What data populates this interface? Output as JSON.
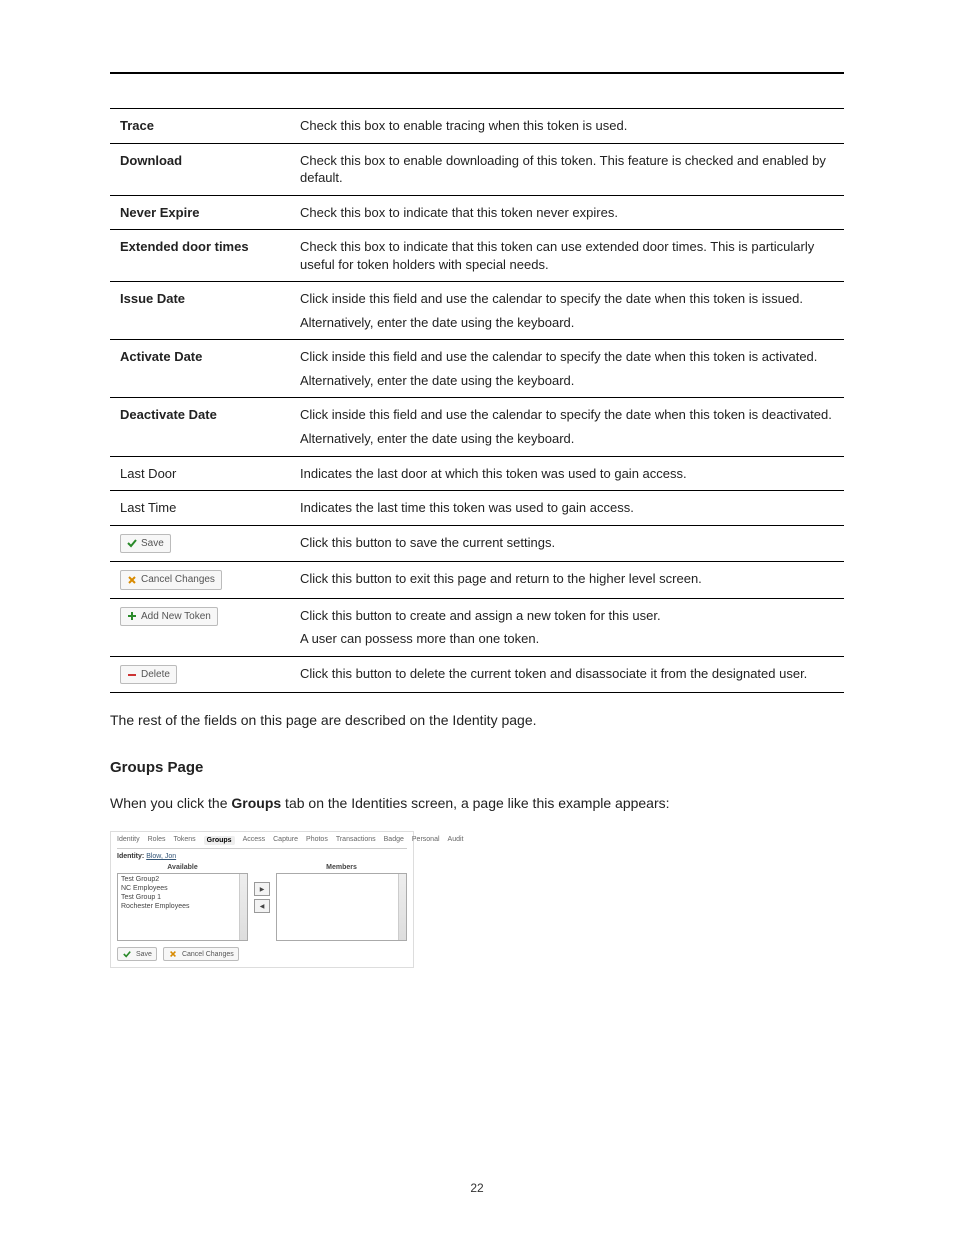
{
  "table": {
    "rows": [
      {
        "label": "Trace",
        "bold": true,
        "btn": null,
        "paras": [
          "Check this box to enable tracing when this token is used."
        ]
      },
      {
        "label": "Download",
        "bold": true,
        "btn": null,
        "paras": [
          "Check this box to enable downloading of this token. This feature is checked and enabled by default."
        ]
      },
      {
        "label": "Never Expire",
        "bold": true,
        "btn": null,
        "paras": [
          "Check this box to indicate that this token never expires."
        ]
      },
      {
        "label": "Extended door times",
        "bold": true,
        "btn": null,
        "paras": [
          "Check this box to indicate that this token can use extended door times. This is particularly useful for token holders with special needs."
        ]
      },
      {
        "label": "Issue Date",
        "bold": true,
        "btn": null,
        "paras": [
          "Click inside this field and use the calendar to specify the date when this token is issued.",
          "Alternatively, enter the date using the keyboard."
        ]
      },
      {
        "label": "Activate Date",
        "bold": true,
        "btn": null,
        "paras": [
          "Click inside this field and use the calendar to specify the date when this token is activated.",
          "Alternatively, enter the date using the keyboard."
        ]
      },
      {
        "label": "Deactivate Date",
        "bold": true,
        "btn": null,
        "paras": [
          "Click inside this field and use the calendar to specify the date when this token is deactivated.",
          "Alternatively, enter the date using the keyboard."
        ]
      },
      {
        "label": "Last Door",
        "bold": false,
        "btn": null,
        "paras": [
          "Indicates the last door at which this token was used to gain access."
        ]
      },
      {
        "label": "Last Time",
        "bold": false,
        "btn": null,
        "paras": [
          "Indicates the last time this token was used to gain access."
        ]
      },
      {
        "label": "",
        "bold": false,
        "btn": {
          "icon": "check",
          "text": "Save"
        },
        "paras": [
          "Click this button to save the current settings."
        ]
      },
      {
        "label": "",
        "bold": false,
        "btn": {
          "icon": "cancel",
          "text": "Cancel Changes"
        },
        "paras": [
          "Click this button to exit this page and return to the higher level screen."
        ]
      },
      {
        "label": "",
        "bold": false,
        "btn": {
          "icon": "plus",
          "text": "Add New Token"
        },
        "paras": [
          "Click this button to create and assign a new token for this user.",
          "A user can possess more than one token."
        ]
      },
      {
        "label": "",
        "bold": false,
        "btn": {
          "icon": "minus",
          "text": "Delete"
        },
        "paras": [
          "Click this button to delete the current token and disassociate it from the designated user."
        ]
      }
    ]
  },
  "body_after_table": "The rest of the fields on this page are described on the Identity page.",
  "section_heading": "Groups Page",
  "groups_intro_prefix": "When you click the ",
  "groups_intro_bold": "Groups",
  "groups_intro_suffix": " tab on the Identities screen, a page like this example appears:",
  "screenshot": {
    "tabs": [
      "Identity",
      "Roles",
      "Tokens",
      "Groups",
      "Access",
      "Capture",
      "Photos",
      "Transactions",
      "Badge",
      "Personal",
      "Audit"
    ],
    "active_tab": "Groups",
    "identity_label": "Identity:",
    "identity_value": "Blow, Jon",
    "available_title": "Available",
    "members_title": "Members",
    "available_items": [
      "Test Group2",
      "NC Employees",
      "Test Group 1",
      "Rochester Employees"
    ],
    "btn_save": "Save",
    "btn_cancel": "Cancel Changes"
  },
  "page_number": "22"
}
